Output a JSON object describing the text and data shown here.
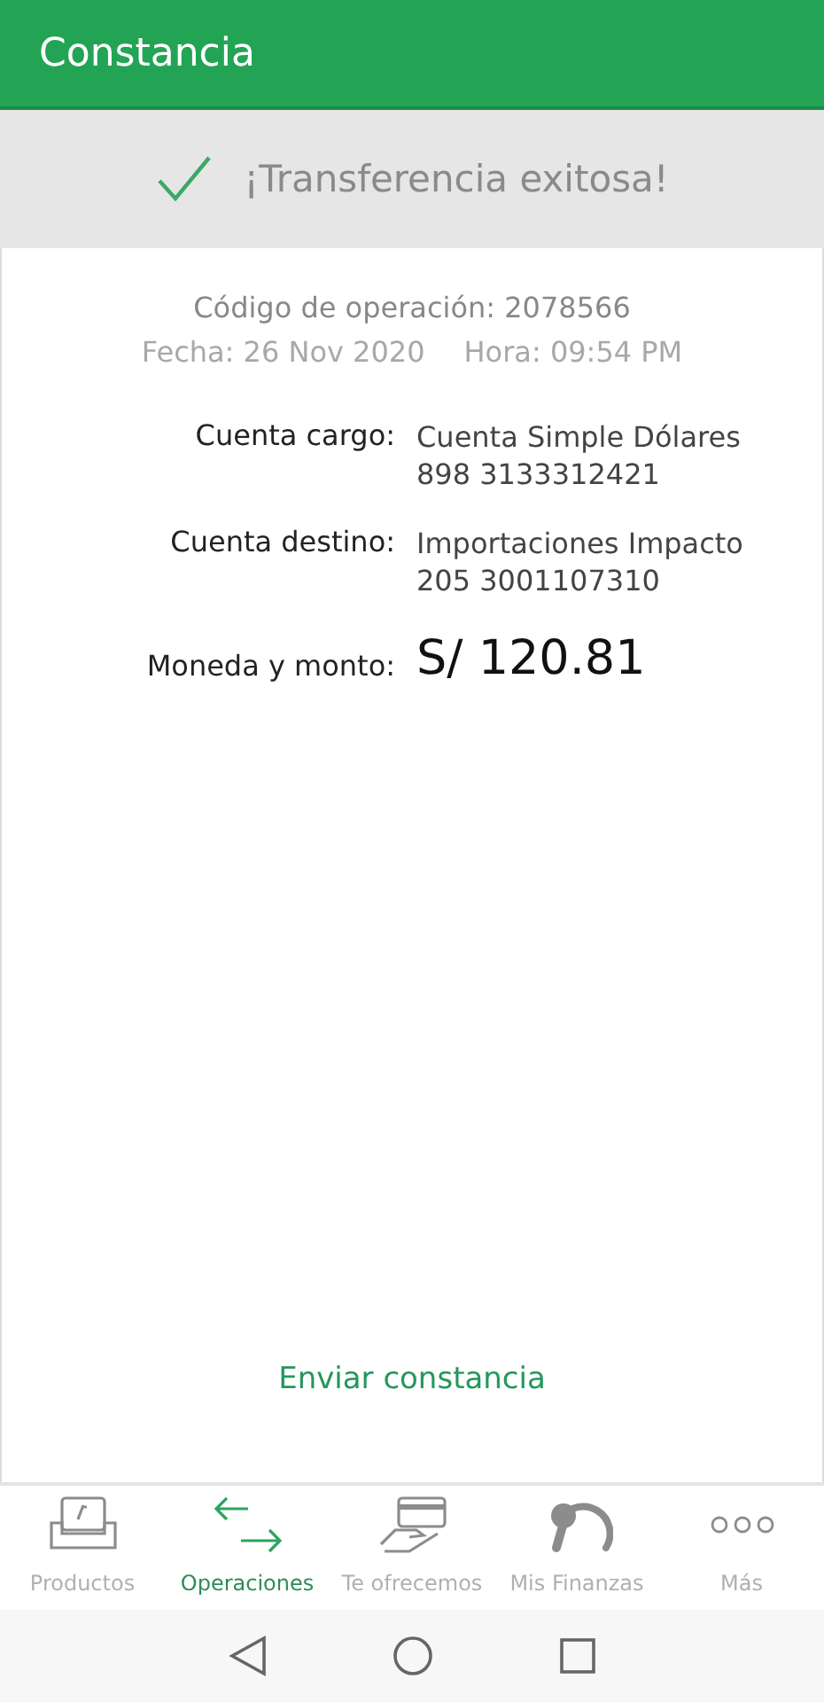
{
  "header": {
    "title": "Constancia"
  },
  "banner": {
    "message": "¡Transferencia exitosa!"
  },
  "operation": {
    "code": "Código de operación: 2078566",
    "date": "Fecha: 26 Nov 2020",
    "time": "Hora: 09:54 PM"
  },
  "details": [
    {
      "label": "Cuenta cargo:",
      "lines": [
        "Cuenta Simple Dólares",
        "898 3133312421"
      ],
      "kind": "text"
    },
    {
      "label": "Cuenta destino:",
      "lines": [
        "Importaciones Impacto",
        "205 3001107310"
      ],
      "kind": "text"
    },
    {
      "label": "Moneda y monto:",
      "lines": [
        "S/ 120.81"
      ],
      "kind": "amount"
    }
  ],
  "send_link": "Enviar constancia",
  "tabs": [
    {
      "label": "Productos",
      "kind": "tray",
      "selected": false
    },
    {
      "label": "Operaciones",
      "kind": "transfer",
      "selected": true
    },
    {
      "label": "Te ofrecemos",
      "kind": "hand",
      "selected": false
    },
    {
      "label": "Mis Finanzas",
      "kind": "gauge",
      "selected": false
    },
    {
      "label": "Más",
      "kind": "more",
      "selected": false
    }
  ]
}
